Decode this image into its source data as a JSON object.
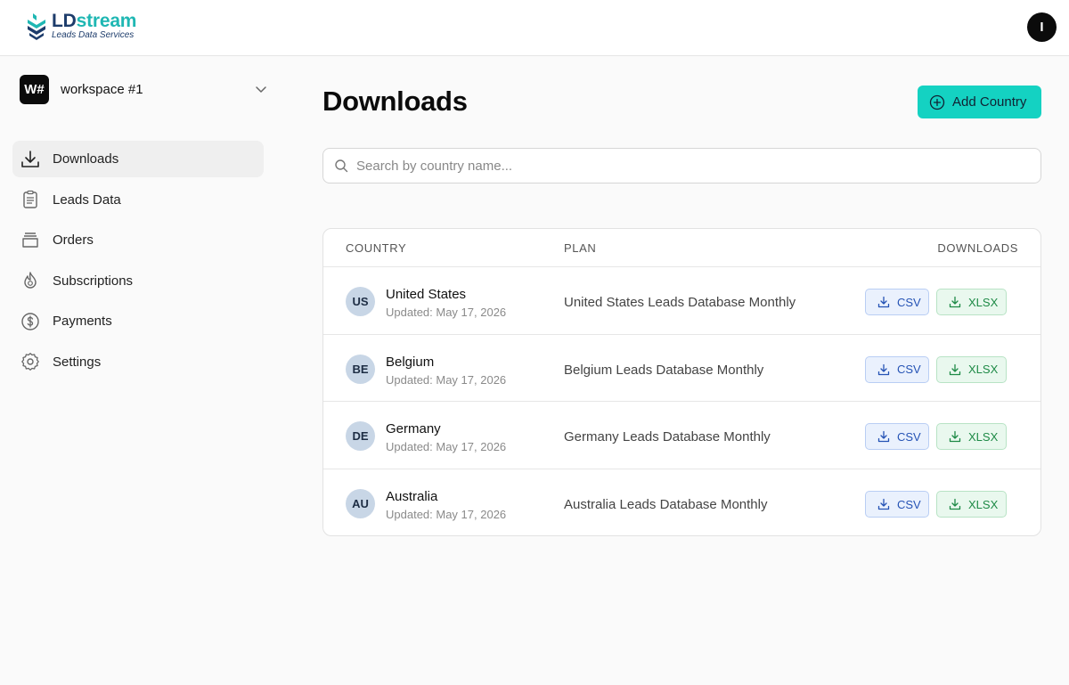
{
  "header": {
    "brand_a": "LD",
    "brand_b": "stream",
    "brand_sub": "Leads Data Services",
    "user_initial": "I"
  },
  "workspace": {
    "badge": "W#",
    "name": "workspace #1"
  },
  "sidebar": {
    "items": [
      {
        "label": "Downloads",
        "icon": "download-icon",
        "active": true
      },
      {
        "label": "Leads Data",
        "icon": "clipboard-icon",
        "active": false
      },
      {
        "label": "Orders",
        "icon": "archive-icon",
        "active": false
      },
      {
        "label": "Subscriptions",
        "icon": "flame-icon",
        "active": false
      },
      {
        "label": "Payments",
        "icon": "dollar-circle-icon",
        "active": false
      },
      {
        "label": "Settings",
        "icon": "gear-icon",
        "active": false
      }
    ]
  },
  "main": {
    "title": "Downloads",
    "add_button_label": "Add Country",
    "search_placeholder": "Search by country name...",
    "search_value": "",
    "columns": {
      "country": "COUNTRY",
      "plan": "PLAN",
      "downloads": "DOWNLOADS"
    },
    "rows": [
      {
        "code": "US",
        "country": "United States",
        "updated": "Updated: May 17, 2026",
        "plan": "United States Leads Database Monthly",
        "csv": "CSV",
        "xlsx": "XLSX"
      },
      {
        "code": "BE",
        "country": "Belgium",
        "updated": "Updated: May 17, 2026",
        "plan": "Belgium Leads Database Monthly",
        "csv": "CSV",
        "xlsx": "XLSX"
      },
      {
        "code": "DE",
        "country": "Germany",
        "updated": "Updated: May 17, 2026",
        "plan": "Germany Leads Database Monthly",
        "csv": "CSV",
        "xlsx": "XLSX"
      },
      {
        "code": "AU",
        "country": "Australia",
        "updated": "Updated: May 17, 2026",
        "plan": "Australia Leads Database Monthly",
        "csv": "CSV",
        "xlsx": "XLSX"
      }
    ]
  },
  "colors": {
    "accent": "#14d2c2",
    "brand_navy": "#1d3c6b",
    "brand_teal": "#1fb7b3",
    "csv_blue": "#2553b5",
    "xlsx_green": "#1e8a46"
  }
}
